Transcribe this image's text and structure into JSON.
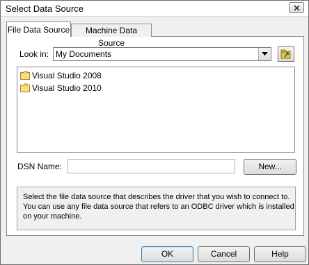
{
  "window": {
    "title": "Select Data Source"
  },
  "tabs": [
    {
      "label": "File Data Source",
      "selected": true
    },
    {
      "label": "Machine Data Source",
      "selected": false
    }
  ],
  "look_in": {
    "label": "Look in:",
    "value": "My Documents"
  },
  "file_list": {
    "items": [
      {
        "name": "Visual Studio 2008",
        "icon": "folder-icon"
      },
      {
        "name": "Visual Studio 2010",
        "icon": "folder-icon"
      }
    ]
  },
  "dsn": {
    "label": "DSN Name:",
    "value": ""
  },
  "buttons": {
    "new_label": "New...",
    "ok_label": "OK",
    "cancel_label": "Cancel",
    "help_label": "Help"
  },
  "description": "Select the file data source that describes the driver that you wish to connect to. You can use any file data source that refers to an ODBC driver which is installed on your machine.",
  "icons": {
    "close": "close-icon",
    "dropdown": "chevron-down-icon",
    "up_folder": "up-folder-icon"
  }
}
